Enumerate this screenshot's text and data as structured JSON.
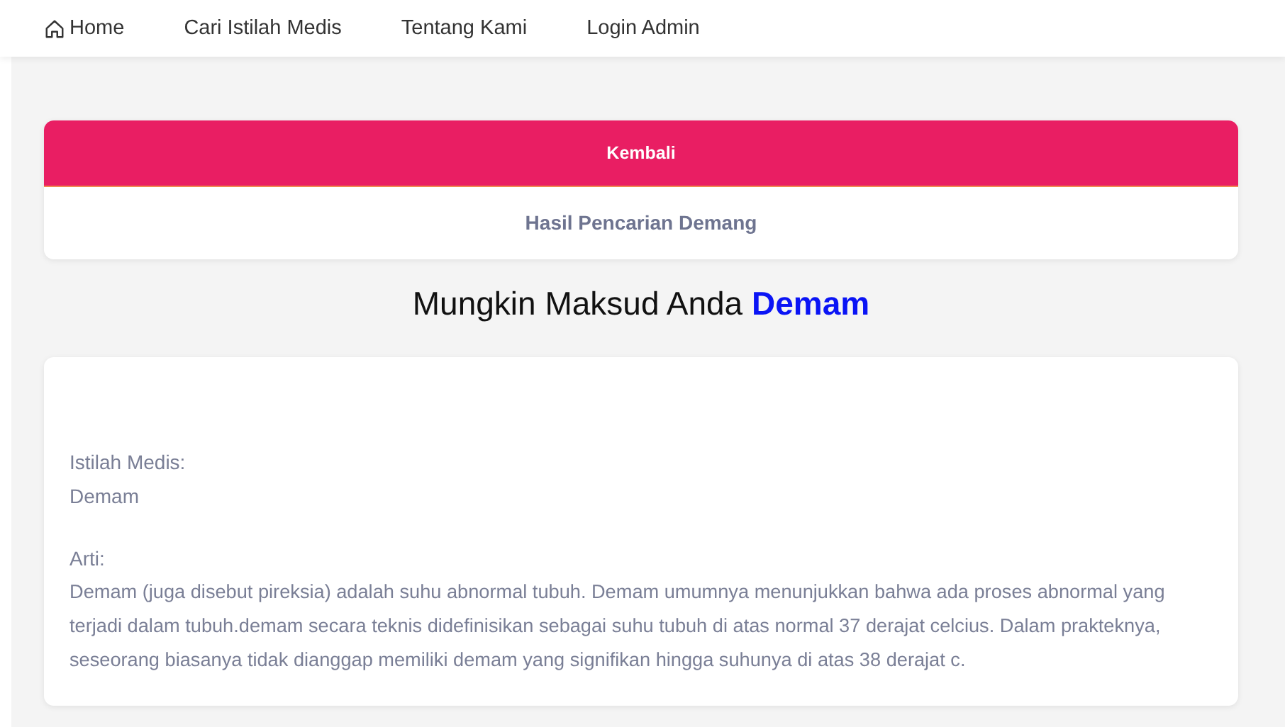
{
  "nav": [
    {
      "label": "Home",
      "kind": "home"
    },
    {
      "label": "Cari Istilah Medis",
      "kind": "link"
    },
    {
      "label": "Tentang Kami",
      "kind": "link"
    },
    {
      "label": "Login Admin",
      "kind": "link"
    }
  ],
  "result_card": {
    "back_button": "Kembali",
    "caption": "Hasil Pencarian Demang"
  },
  "suggestion": {
    "prefix": "Mungkin Maksud Anda",
    "link": "Demam"
  },
  "definition_card": {
    "term_label": "Istilah Medis:",
    "term": "Demam",
    "meaning_label": "Arti:",
    "meaning": "Demam (juga disebut pireksia) adalah suhu abnormal tubuh. Demam umumnya menunjukkan bahwa ada proses abnormal yang terjadi dalam tubuh.demam secara teknis didefinisikan sebagai suhu tubuh di atas normal 37 derajat celcius. Dalam prakteknya, seseorang biasanya tidak dianggap memiliki demam yang signifikan hingga suhunya di atas 38 derajat c."
  }
}
